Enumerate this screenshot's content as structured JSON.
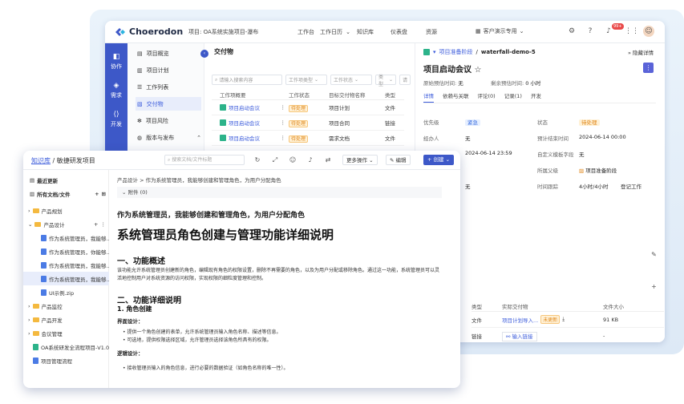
{
  "back": {
    "logo": "Choerodon",
    "project": "项目: OA系统实施项目-瀑布",
    "topnav": [
      "工作台",
      "工作日历",
      "知识库",
      "仪表盘",
      "资源"
    ],
    "client": "客户演示专用",
    "badge": "99+",
    "rail": [
      "协作",
      "需求",
      "开发"
    ],
    "subnav": [
      "项目概览",
      "项目计划",
      "工作列表",
      "交付物",
      "项目风险",
      "版本与发布"
    ],
    "deliv_title": "交付物",
    "filters": {
      "search": "请输入搜索内容",
      "type": "工作项类型",
      "status": "工作状态",
      "kind": "类型",
      "search2": "请"
    },
    "table": {
      "headers": [
        "工作项概要",
        "工作状态",
        "目标交付物名称",
        "类型"
      ],
      "rows": [
        {
          "name": "项目启动会议",
          "status": "待处理",
          "target": "项目计划",
          "type": "文件"
        },
        {
          "name": "项目启动会议",
          "status": "待处理",
          "target": "项目合同",
          "type": "链接"
        },
        {
          "name": "项目启动会议",
          "status": "待处理",
          "target": "需求文档",
          "type": "文件"
        }
      ]
    },
    "detail": {
      "crumb1": "项目准备阶段",
      "crumb2": "waterfall-demo-5",
      "hide": "隐藏详情",
      "title": "项目启动会议",
      "meta_label1": "原始预估时间:",
      "meta_val1": "无",
      "meta_label2": "剩余预估时间:",
      "meta_val2": "0 小时",
      "tabs": [
        "详情",
        "依赖与关联",
        "评论(0)",
        "记录(1)",
        "开发"
      ],
      "f_priority": "优先级",
      "v_priority": "紧急",
      "f_status": "状态",
      "v_status": "待处理",
      "f_handler": "经办人",
      "v_handler": "无",
      "f_est_end": "预计结束时间",
      "v_est_end": "2024-06-14 00:00",
      "v_time": "2024-06-14 23:59",
      "f_custom": "自定义模板字段",
      "v_custom": "无",
      "f_parent": "所属父级",
      "v_parent": "项目准备阶段",
      "v_none3": "无",
      "f_track": "时间跟踪",
      "v_track": "4小时/4小时",
      "v_log": "登记工作",
      "act_headers": [
        "类型",
        "实际交付物",
        "文件大小"
      ],
      "act_rows": [
        {
          "type": "文件",
          "name": "项目计划导入...",
          "tag": "未更新",
          "size": "91 KB"
        },
        {
          "type": "链接",
          "name": "输入链接",
          "size": "-"
        },
        {
          "type": "",
          "name": "",
          "size": "-"
        }
      ]
    }
  },
  "front": {
    "crumb_root": "知识库",
    "crumb_sep": "/",
    "crumb_name": "敏捷研发项目",
    "search": "搜索文档/文件标题",
    "more": "更多操作",
    "edit": "编辑",
    "create": "创建",
    "tree": {
      "recent": "最近更新",
      "all": "所有文档/文件",
      "items": [
        {
          "label": "产品规划",
          "kind": "folder"
        },
        {
          "label": "产品设计",
          "kind": "folder"
        },
        {
          "label": "作为系统管理员，我能够...",
          "kind": "doc"
        },
        {
          "label": "作为系统管理员，你能够...",
          "kind": "doc"
        },
        {
          "label": "作为系统管理员，我能够...",
          "kind": "doc"
        },
        {
          "label": "作为系统管理员，我能够...",
          "kind": "doc"
        },
        {
          "label": "UI示例.zip",
          "kind": "doc"
        },
        {
          "label": "产品监控",
          "kind": "folder"
        },
        {
          "label": "产品开发",
          "kind": "folder"
        },
        {
          "label": "会议管理",
          "kind": "folder"
        },
        {
          "label": "OA系统研发全流程项目-V1.0...",
          "kind": "doc-g"
        },
        {
          "label": "项目管理流程",
          "kind": "doc"
        }
      ]
    },
    "content": {
      "crumb": "产品设计 > 作为系统管理员，我能够创建和管理角色，为用户分配角色",
      "attach": "附件 (0)",
      "subtitle": "作为系统管理员，我能够创建和管理角色，为用户分配角色",
      "title": "系统管理员角色创建与管理功能详细说明",
      "s1": "一、功能概述",
      "p1": "该功能允许系统管理员创建新的角色，编辑现有角色的权限设置，删除不再需要的角色，以及为用户分配或移除角色。通过这一功能，系统管理员可以灵活地控制用户对系统资源的访问权限，实现权限的细粒度管理和控制。",
      "s2": "二、功能详细说明",
      "s2_1": "1. 角色创建",
      "ui": "界面设计：",
      "ui1": "提供一个角色创建的表单，允许系统管理员输入角色名称、描述等信息。",
      "ui2": "可选地，提供权限选择区域，允许管理员选择该角色所具有的权限。",
      "logic": "逻辑设计：",
      "logic1": "接收管理员输入的角色信息，进行必要的数据验证（如角色名称的唯一性）。"
    }
  }
}
